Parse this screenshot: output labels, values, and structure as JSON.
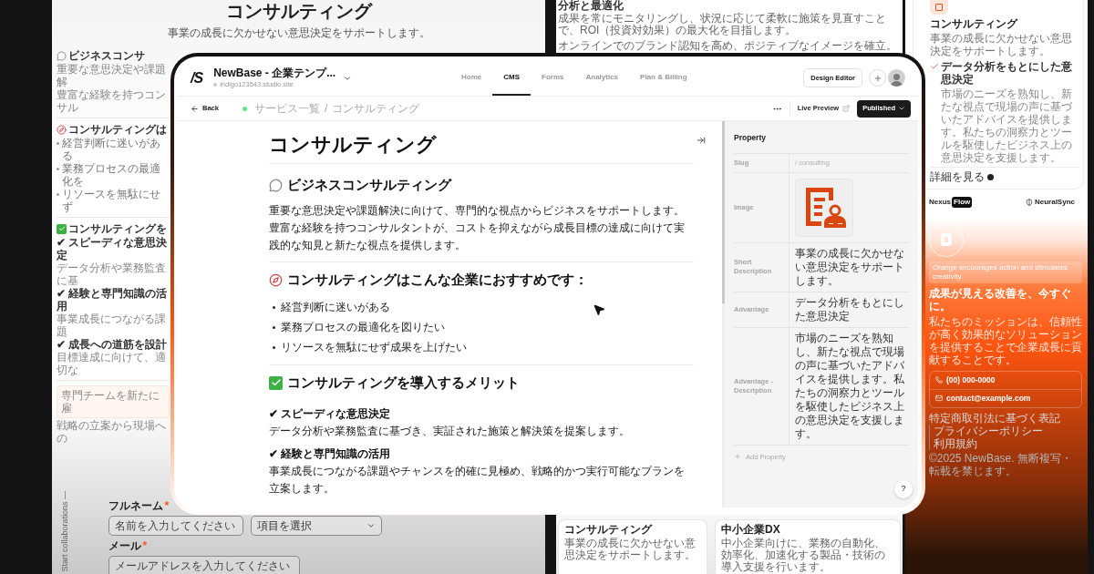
{
  "left_page": {
    "title": "コンサルティング",
    "subtitle": "事業の成長に欠かせない意思決定をサポートします。",
    "items": [
      {
        "kind": "heading_comment",
        "text": "ビジネスコンサ"
      },
      {
        "kind": "text",
        "text": "重要な意思決定や課題解"
      },
      {
        "kind": "text",
        "text": "豊富な経験を持つコンサル"
      },
      {
        "kind": "rule"
      },
      {
        "kind": "heading_compass",
        "text": "コンサルティングは"
      },
      {
        "kind": "bullet",
        "text": "経営判断に迷いがある"
      },
      {
        "kind": "bullet",
        "text": "業務プロセスの最適化を"
      },
      {
        "kind": "bullet",
        "text": "リソースを無駄にせず"
      },
      {
        "kind": "rule"
      },
      {
        "kind": "heading_check",
        "text": "コンサルティングを"
      },
      {
        "kind": "point",
        "text": "✔ スピーディな意思決定"
      },
      {
        "kind": "text",
        "text": "データ分析や業務監査に基"
      },
      {
        "kind": "point",
        "text": "✔ 経験と専門知識の活用"
      },
      {
        "kind": "text",
        "text": "事業成長につながる課題"
      },
      {
        "kind": "point",
        "text": "✔ 成長への道筋を設計"
      },
      {
        "kind": "text",
        "text": "目標達成に向けて、適切な"
      },
      {
        "kind": "rule"
      },
      {
        "kind": "callout",
        "text": "専門チームを新たに雇"
      },
      {
        "kind": "text",
        "text": "戦略の立案から現場への"
      }
    ],
    "side_label": "Start collaborations —",
    "form": {
      "name_label": "フルネーム",
      "name_mark": "*",
      "name_placeholder": "名前を入力してください",
      "select_value": "項目を選択",
      "email_label": "メール",
      "email_mark": "*",
      "email_placeholder": "メールアドレスを入力してください"
    }
  },
  "middle_page": {
    "heading": "分析と最適化",
    "text": "成果を常にモニタリングし、状況に応じて柔軟に施策を見直すことで、ROI（投資対効果）の最大化を目指します。",
    "text2": "オンラインでのブランド認知を高め、ポジティブなイメージを確立。",
    "cards": [
      {
        "title": "コンサルティング",
        "text": "事業の成長に欠かせない意思決定をサポートします。"
      },
      {
        "title": "中小企業DX",
        "text": "中小企業向けに、業務の自動化、効率化、加速化する製品・技術の導入支援を行います。"
      }
    ]
  },
  "right_page": {
    "card": {
      "title": "コンサルティング",
      "text": "事業の成長に欠かせない意思決定をサポートします。",
      "point": "データ分析をもとにした意思決定",
      "point_text": "市場のニーズを熟知し、新たな視点で現場の声に基づいたアドバイスを提供します。私たちの洞察力とツールを駆使したビジネス上の意思決定を支援します。",
      "link": "詳細を見る"
    },
    "logos": [
      {
        "kind": "badge",
        "text": "Nexus",
        "badge": "Flow"
      },
      {
        "kind": "shield",
        "text": "NeuralSync"
      }
    ],
    "tag": "Orange encourages action and stimulates creativity.",
    "heading": "成果が見える改善を、今すぐに。",
    "text": "私たちのミッションは、信頼性が高く効果的なソリューションを提供することで企業成長に貢献することです。",
    "contacts": [
      {
        "kind": "phone",
        "text": "(00) 000-0000"
      },
      {
        "kind": "mail",
        "text": "contact@example.com"
      }
    ],
    "links": [
      "特定商取引法に基づく表記",
      "プライバシーポリシー",
      "利用規約"
    ],
    "copyright": "©2025 NewBase. 無断複写・転載を禁じます。"
  },
  "app": {
    "logo": "/S",
    "site_name": "NewBase - 企業テンプ...",
    "site_url": "indigo123543.studio.site",
    "nav": [
      {
        "label": "Home",
        "selected": false
      },
      {
        "label": "CMS",
        "selected": true
      },
      {
        "label": "Forms",
        "selected": false
      },
      {
        "label": "Analytics",
        "selected": false
      },
      {
        "label": "Plan & Billing",
        "selected": false
      }
    ],
    "design_editor": "Design Editor",
    "back": "Back",
    "breadcrumb": [
      "サービス一覧",
      "コンサルティング"
    ],
    "breadcrumb_separator": "/",
    "live_preview": "Live Preview",
    "publish": "Published",
    "document": [
      {
        "kind": "title",
        "text": "コンサルティング"
      },
      {
        "kind": "heading_comment",
        "text": "ビジネスコンサルティング"
      },
      {
        "kind": "paragraph",
        "text": "重要な意思決定や課題解決に向けて、専門的な視点からビジネスをサポートします。"
      },
      {
        "kind": "paragraph",
        "text": "豊富な経験を持つコンサルタントが、コストを抑えながら成長目標の達成に向けて実践的な知見と新たな視点を提供します。"
      },
      {
        "kind": "rule"
      },
      {
        "kind": "heading_compass",
        "text": "コンサルティングはこんな企業におすすめです："
      },
      {
        "kind": "bullet",
        "text": "経営判断に迷いがある"
      },
      {
        "kind": "bullet",
        "text": "業務プロセスの最適化を図りたい"
      },
      {
        "kind": "bullet",
        "text": "リソースを無駄にせず成果を上げたい"
      },
      {
        "kind": "rule"
      },
      {
        "kind": "heading_check",
        "text": "コンサルティングを導入するメリット"
      },
      {
        "kind": "point",
        "text": "✔ スピーディな意思決定"
      },
      {
        "kind": "paragraph",
        "text": "データ分析や業務監査に基づき、実証された施策と解決策を提案します。"
      },
      {
        "kind": "point",
        "text": "✔ 経験と専門知識の活用"
      },
      {
        "kind": "paragraph",
        "text": "事業成長につながる課題やチャンスを的確に見極め、戦略的かつ実行可能なプランを立案します。"
      }
    ],
    "panel": {
      "title": "Property",
      "rows": [
        {
          "kind": "slug",
          "label": "Slug",
          "value": "/ consulting"
        },
        {
          "kind": "image",
          "label": "Image"
        },
        {
          "kind": "text",
          "label": "Short Description",
          "value": "事業の成長に欠かせない意思決定をサポートします。"
        },
        {
          "kind": "text",
          "label": "Advantage",
          "value": "データ分析をもとにした意思決定"
        },
        {
          "kind": "text",
          "label": "Advantage - Description",
          "value": "市場のニーズを熟知し、新たな視点で現場の声に基づいたアドバイスを提供します。私たちの洞察力とツールを駆使したビジネス上の意思決定を支援します。"
        }
      ],
      "add": "Add Property"
    },
    "help": "?"
  }
}
